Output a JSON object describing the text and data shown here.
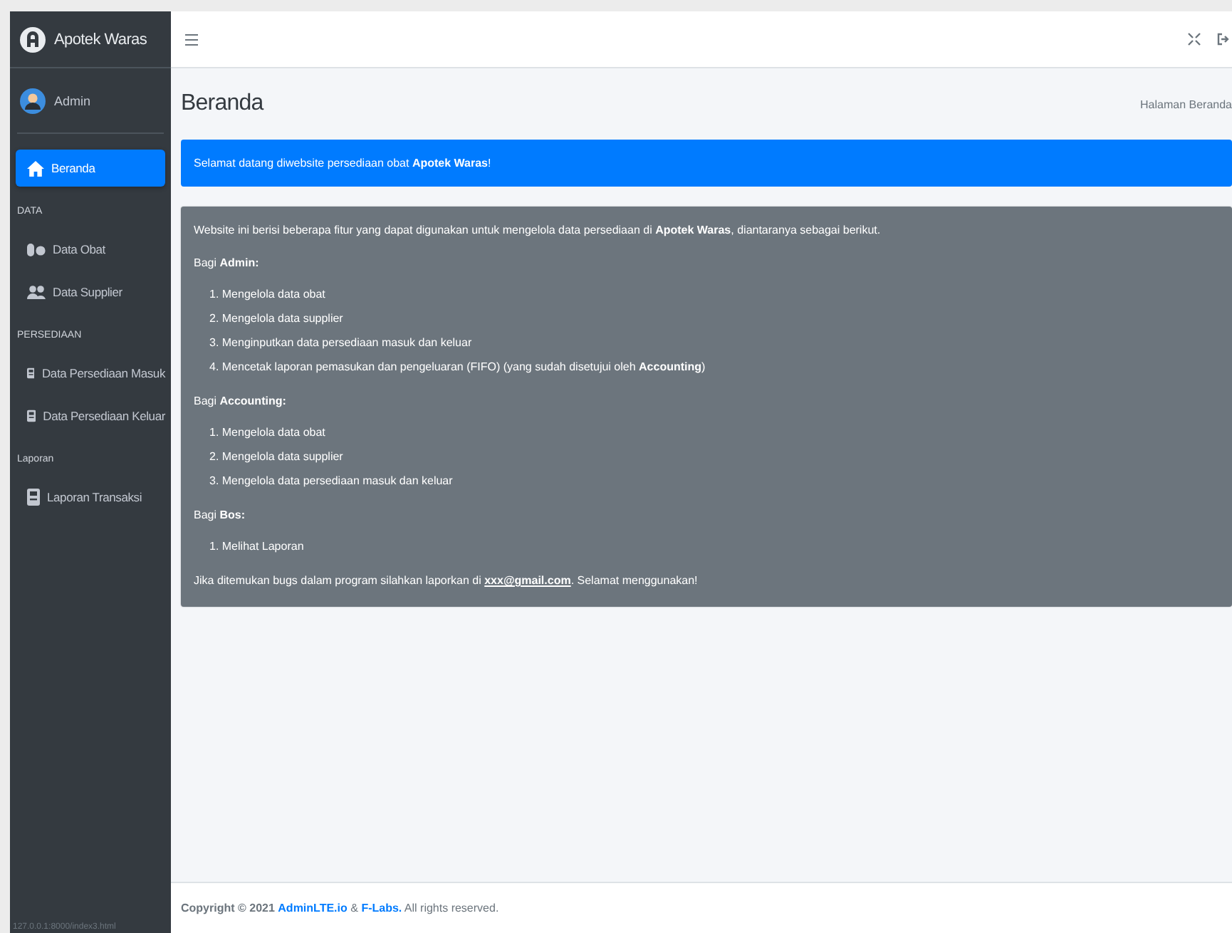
{
  "sidebar": {
    "brand": "Apotek Waras",
    "user": "Admin",
    "nav": [
      {
        "kind": "item",
        "label": "Beranda",
        "selected": true
      },
      {
        "kind": "header",
        "label": "DATA"
      },
      {
        "kind": "item",
        "label": "Data Obat",
        "selected": false
      },
      {
        "kind": "item",
        "label": "Data Supplier",
        "selected": false
      },
      {
        "kind": "header",
        "label": "PERSEDIAAN"
      },
      {
        "kind": "item",
        "label": "Data Persediaan Masuk",
        "selected": false
      },
      {
        "kind": "item",
        "label": "Data Persediaan Keluar",
        "selected": false
      },
      {
        "kind": "header",
        "label": "Laporan"
      },
      {
        "kind": "item",
        "label": "Laporan Transaksi",
        "selected": false
      }
    ],
    "status_url": "127.0.0.1:8000/index3.html"
  },
  "page": {
    "title": "Beranda",
    "breadcrumb": "Halaman Beranda"
  },
  "welcome": "Selamat datang diwebsite persediaan obat **Apotek Waras**!",
  "card": {
    "intro": "Website ini berisi beberapa fitur yang dapat digunakan untuk mengelola data persediaan di **Apotek Waras**, diantaranya sebagai berikut.",
    "sections": [
      {
        "heading": "Bagi **Admin:**",
        "items": [
          "1. Mengelola data obat",
          "2. Mengelola data supplier",
          "3. Menginputkan data persediaan masuk dan keluar",
          "4. Mencetak laporan pemasukan dan pengeluaran (FIFO) (yang sudah disetujui oleh **Accounting**)"
        ]
      },
      {
        "heading": "Bagi **Accounting:**",
        "items": [
          "1. Mengelola data obat",
          "2. Mengelola data supplier",
          "3. Mengelola data persediaan masuk dan keluar"
        ]
      },
      {
        "heading": "Bagi **Bos:**",
        "items": [
          "1. Melihat Laporan"
        ]
      }
    ],
    "closing": {
      "before": "Jika ditemukan bugs dalam program silahkan laporkan di",
      "link": "xxx@gmail.com",
      "after": ". Selamat menggunakan!"
    }
  },
  "footer": [
    {
      "kind": "strong",
      "text": "Copyright © 2021"
    },
    {
      "kind": "link",
      "text": "AdminLTE.io"
    },
    {
      "kind": "text",
      "text": "&"
    },
    {
      "kind": "link",
      "text": "F-Labs."
    },
    {
      "kind": "text",
      "text": "All rights reserved."
    }
  ]
}
